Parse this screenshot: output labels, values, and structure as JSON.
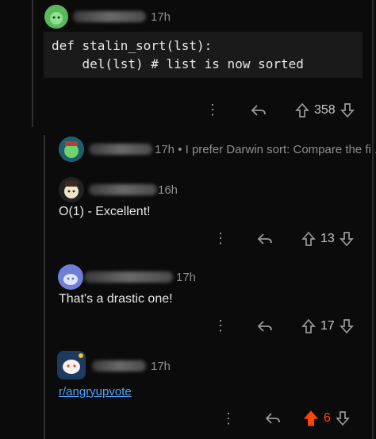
{
  "comments": [
    {
      "time": "17h",
      "code_lines": [
        "def stalin_sort(lst):",
        "    del(lst) # list is now sorted"
      ],
      "score": "358"
    },
    {
      "time": "17h",
      "preview": "I prefer Darwin sort: Compare the fi..."
    },
    {
      "time": "16h",
      "text": "O(1) - Excellent!",
      "score": "13"
    },
    {
      "time": "17h",
      "text": "That's a drastic one!",
      "score": "17"
    },
    {
      "time": "17h",
      "link": "r/angryupvote",
      "score": "6"
    }
  ],
  "icons": {
    "more": "more-options-icon",
    "reply": "reply-icon",
    "upvote": "upvote-arrow-icon",
    "downvote": "downvote-arrow-icon"
  },
  "colors": {
    "background": "#0b0b0b",
    "upvote_active": "#ff4500",
    "link": "#4fa3ff"
  }
}
